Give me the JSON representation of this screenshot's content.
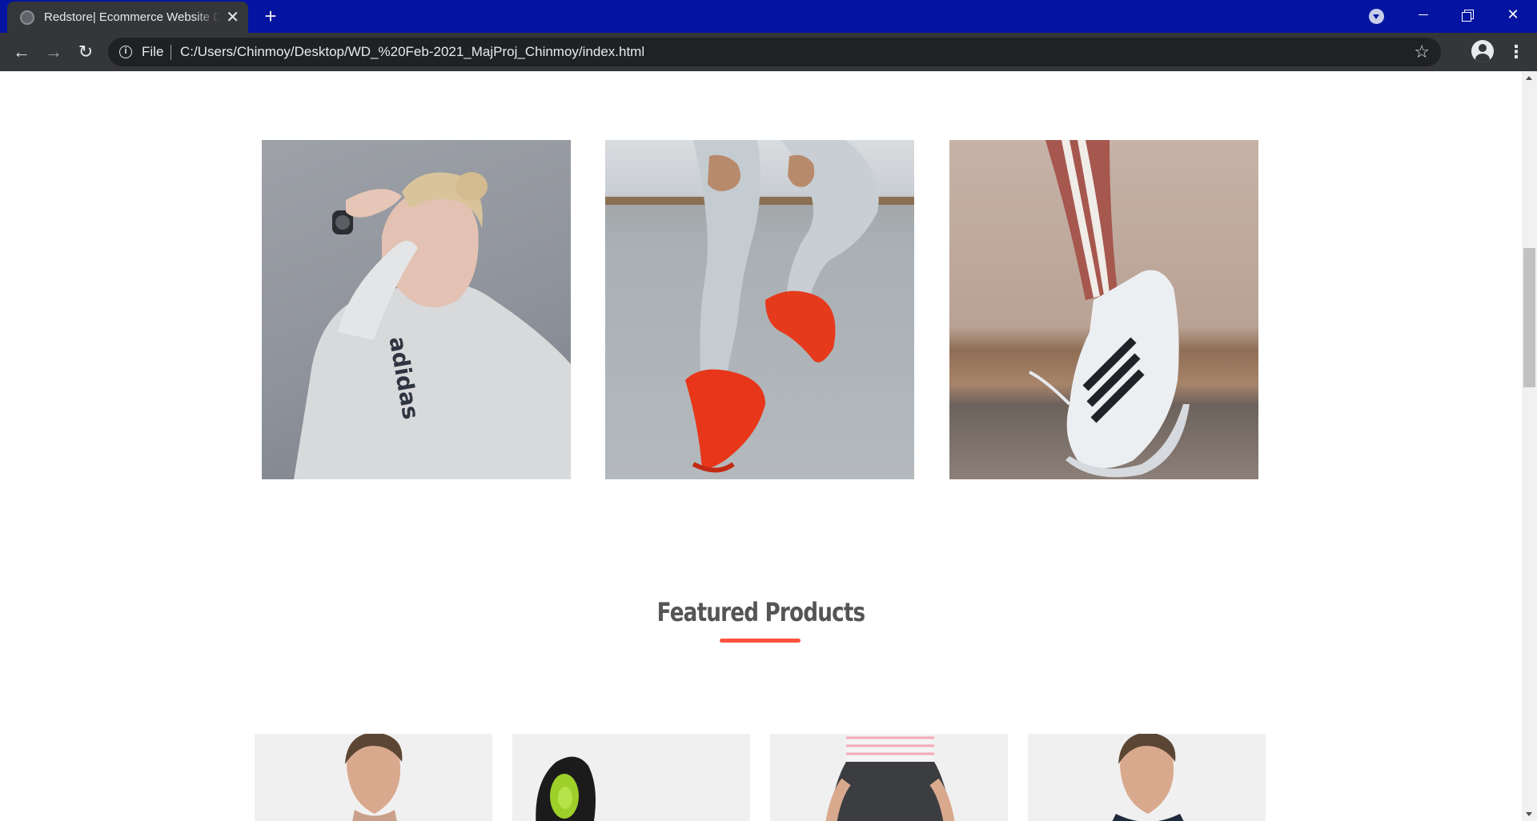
{
  "browser": {
    "tab_title": "Redstore| Ecommerce Website Design",
    "tab_close_glyph": "✕",
    "new_tab_glyph": "+",
    "window_close_glyph": "✕",
    "back_glyph": "←",
    "forward_glyph": "→",
    "reload_glyph": "↻",
    "info_glyph": "i",
    "scheme_label": "File",
    "url": "C:/Users/Chinmoy/Desktop/WD_%20Feb-2021_MajProj_Chinmoy/index.html",
    "star_glyph": "☆",
    "menu_glyph": "⋮",
    "frame_color": "#0414a0",
    "toolbar_color": "#35363a"
  },
  "page": {
    "categories": [
      {
        "name": "category-image-adidas-hoodie-woman"
      },
      {
        "name": "category-image-red-sneakers"
      },
      {
        "name": "category-image-adidas-superstar"
      }
    ],
    "featured_title": "Featured Products",
    "accent_color": "#ff523b",
    "products": [
      {
        "name": "product-image-1"
      },
      {
        "name": "product-image-2"
      },
      {
        "name": "product-image-3"
      },
      {
        "name": "product-image-4"
      }
    ]
  }
}
